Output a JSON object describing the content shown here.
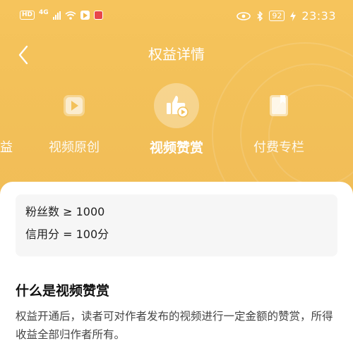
{
  "status_bar": {
    "hd_label": "HD",
    "signal_label": "4G",
    "battery": "92",
    "time": "23:33"
  },
  "header": {
    "title": "权益详情",
    "back_icon": "chevron-left-icon"
  },
  "tabs": [
    {
      "label": "益",
      "icon": "none",
      "partial": true
    },
    {
      "label": "视频原创",
      "icon": "video-play-icon"
    },
    {
      "label": "视频赞赏",
      "icon": "thumbs-up-play-icon",
      "active": true
    },
    {
      "label": "付费专栏",
      "icon": "book-icon"
    }
  ],
  "requirements": {
    "fans": "粉丝数 ≥ 1000",
    "credit": "信用分 = 100分"
  },
  "section": {
    "title": "什么是视频赞赏",
    "description": "权益开通后，读者可对作者发布的视频进行一定金额的赞赏，所得收益全部归作者所有。"
  },
  "colors": {
    "accent": "#f3c159",
    "card_bg": "#f6f6f6"
  }
}
